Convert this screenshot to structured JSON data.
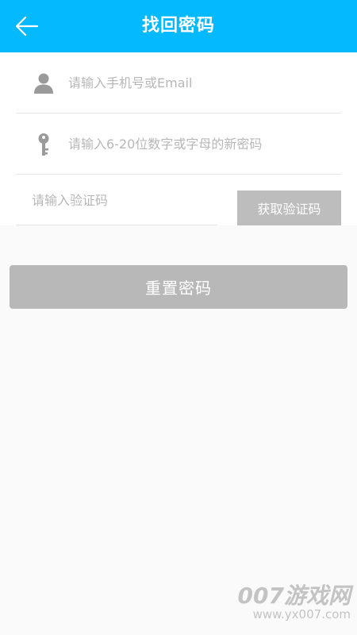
{
  "colors": {
    "brand": "#05b9ff",
    "button_disabled": "#b8b8b8",
    "icon": "#9a9a9a"
  },
  "header": {
    "title": "找回密码",
    "back_icon": "arrow-left-icon"
  },
  "form": {
    "phone_email": {
      "icon": "user-icon",
      "placeholder": "请输入手机号或Email",
      "value": ""
    },
    "new_password": {
      "icon": "key-icon",
      "placeholder": "请输入6-20位数字或字母的新密码",
      "value": ""
    },
    "verification_code": {
      "placeholder": "请输入验证码",
      "value": ""
    },
    "get_code_label": "获取验证码"
  },
  "reset_button_label": "重置密码",
  "watermark": {
    "main": "007游戏网",
    "url": "www.yx007.com"
  }
}
